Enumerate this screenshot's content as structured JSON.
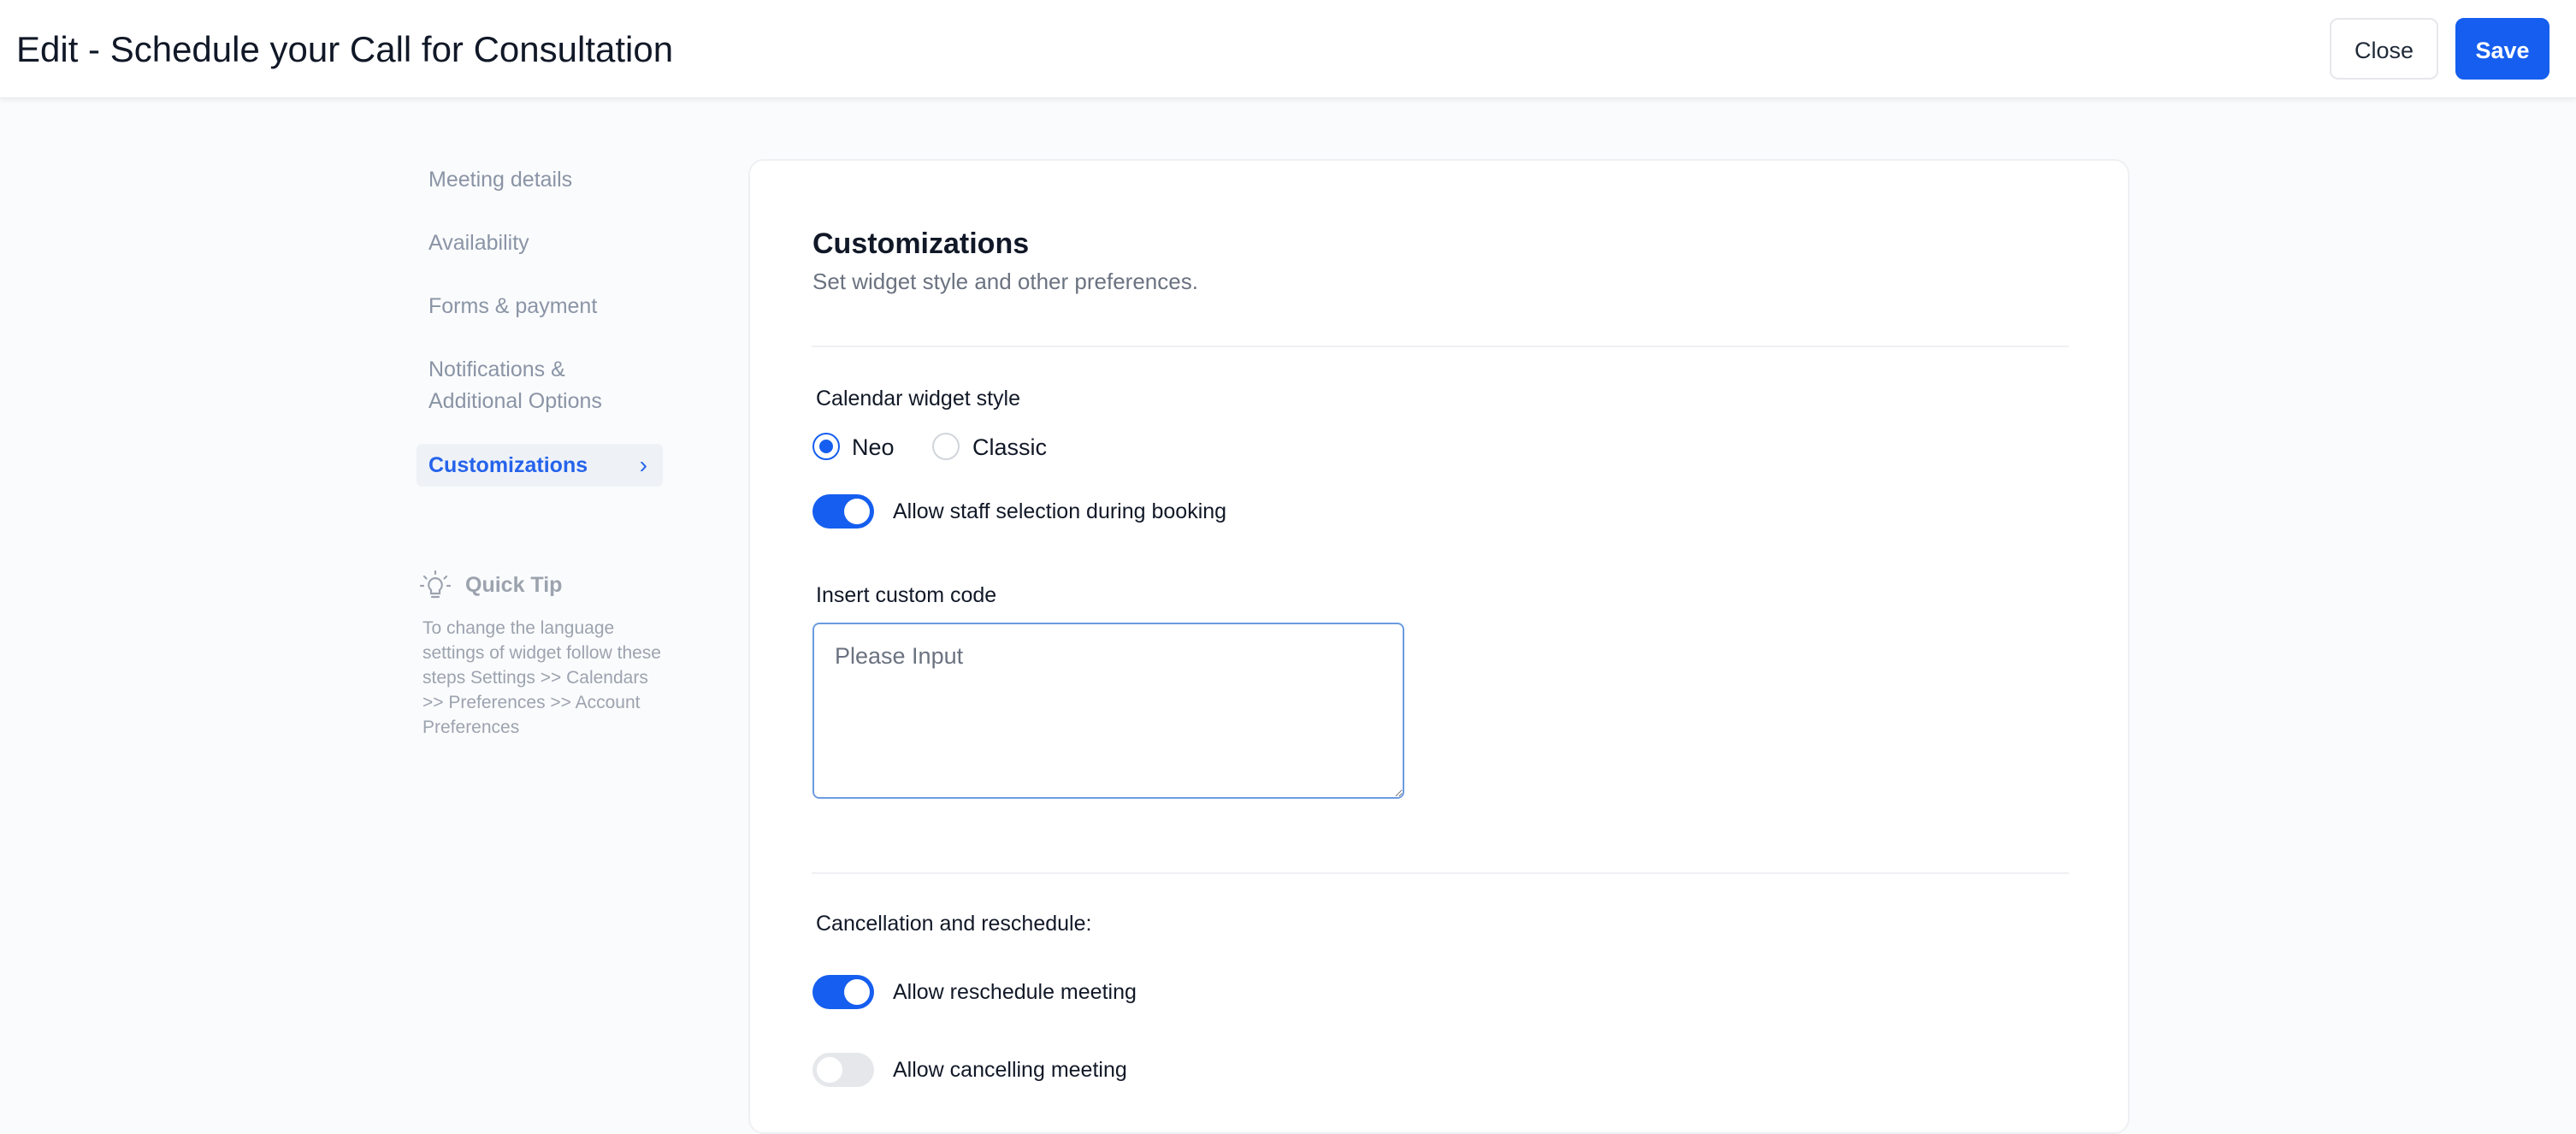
{
  "header": {
    "title": "Edit - Schedule your Call for Consultation",
    "close_label": "Close",
    "save_label": "Save",
    "save_color": "#155eef"
  },
  "nav": {
    "items": [
      {
        "label": "Meeting details"
      },
      {
        "label": "Availability"
      },
      {
        "label": "Forms & payment"
      },
      {
        "label": "Notifications & Additional Options"
      },
      {
        "label": "Customizations",
        "active": true
      }
    ]
  },
  "quick_tip": {
    "title": "Quick Tip",
    "text": "To change the language settings of widget follow these steps Settings >> Calendars >> Preferences >> Account Preferences"
  },
  "customizations": {
    "title": "Customizations",
    "subtitle": "Set widget style and other preferences.",
    "widget_style_label": "Calendar widget style",
    "widget_style_options": [
      "Neo",
      "Classic"
    ],
    "widget_style_selected": "Neo",
    "staff_selection_label": "Allow staff selection during booking",
    "staff_selection_enabled": true,
    "custom_code_label": "Insert custom code",
    "custom_code_placeholder": "Please Input",
    "custom_code_value": ""
  },
  "cancellation": {
    "label": "Cancellation and reschedule:",
    "reschedule_label": "Allow reschedule meeting",
    "reschedule_enabled": true,
    "cancel_label": "Allow cancelling meeting",
    "cancel_enabled": false
  }
}
